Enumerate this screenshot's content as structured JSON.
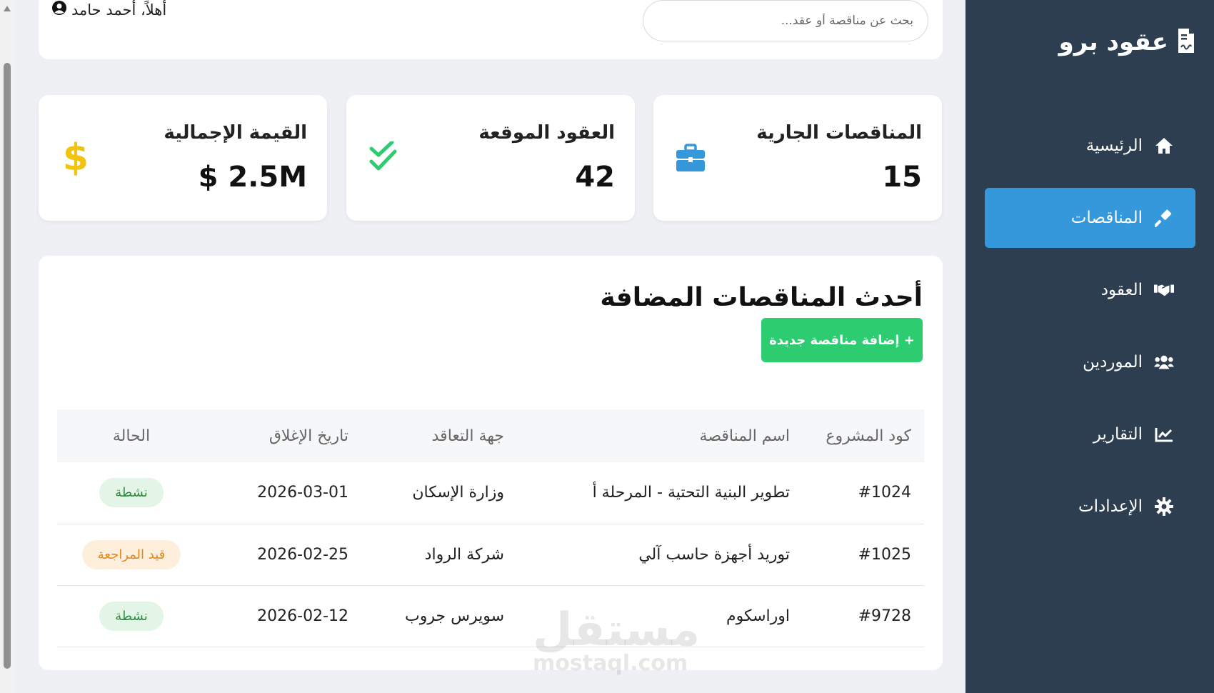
{
  "brand": {
    "name": "عقود برو",
    "icon": "file-contract-icon"
  },
  "nav": [
    {
      "label": "الرئيسية",
      "icon": "home-icon",
      "active": false
    },
    {
      "label": "المناقصات",
      "icon": "gavel-icon",
      "active": true
    },
    {
      "label": "العقود",
      "icon": "handshake-icon",
      "active": false
    },
    {
      "label": "الموردين",
      "icon": "users-icon",
      "active": false
    },
    {
      "label": "التقارير",
      "icon": "chart-line-icon",
      "active": false
    },
    {
      "label": "الإعدادات",
      "icon": "gear-icon",
      "active": false
    }
  ],
  "header": {
    "search_placeholder": "بحث عن مناقصة أو عقد...",
    "greeting": "أهلاً، أحمد حامد"
  },
  "stats": [
    {
      "label": "المناقصات الجارية",
      "value": "15",
      "icon": "briefcase-icon",
      "color": "#3598db"
    },
    {
      "label": "العقود الموقعة",
      "value": "42",
      "icon": "double-check-icon",
      "color": "#2ecc71"
    },
    {
      "label": "القيمة الإجمالية",
      "value": "$ 2.5M",
      "icon": "dollar-icon",
      "color": "#f1c40f"
    }
  ],
  "panel": {
    "title": "أحدث المناقصات المضافة",
    "add_button": "+ إضافة مناقصة جديدة",
    "columns": [
      "كود المشروع",
      "اسم المناقصة",
      "جهة التعاقد",
      "تاريخ الإغلاق",
      "الحالة"
    ],
    "rows": [
      {
        "code": "#1024",
        "name": "تطوير البنية التحتية - المرحلة أ",
        "party": "وزارة الإسكان",
        "date": "2026-03-01",
        "status": "نشطة",
        "status_color": "green"
      },
      {
        "code": "#1025",
        "name": "توريد أجهزة حاسب آلي",
        "party": "شركة الرواد",
        "date": "2026-02-25",
        "status": "قيد المراجعة",
        "status_color": "orange"
      },
      {
        "code": "#9728",
        "name": "اوراسكوم",
        "party": "سويرس جروب",
        "date": "2026-02-12",
        "status": "نشطة",
        "status_color": "green"
      }
    ]
  },
  "watermark": {
    "arabic": "مستقل",
    "latin": "mostaql.com"
  },
  "colors": {
    "sidebar": "#2c3e50",
    "accent": "#3598db",
    "success": "#2ecc71"
  }
}
